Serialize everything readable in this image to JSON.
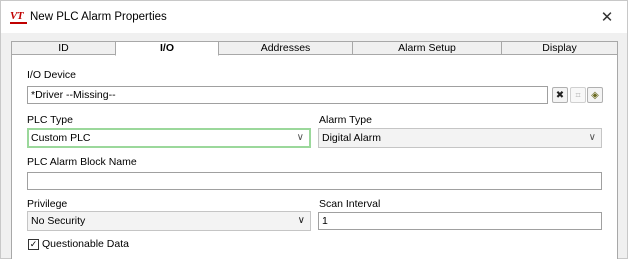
{
  "window": {
    "title": "New PLC Alarm Properties",
    "logo_text": "VT",
    "close_glyph": "✕"
  },
  "tabs": [
    {
      "label": "ID",
      "active": false
    },
    {
      "label": "I/O",
      "active": true
    },
    {
      "label": "Addresses",
      "active": false
    },
    {
      "label": "Alarm Setup",
      "active": false
    },
    {
      "label": "Display",
      "active": false
    }
  ],
  "io_device": {
    "label": "I/O Device",
    "value": "*Driver   --Missing--",
    "buttons": [
      "clear-icon",
      "tree-icon",
      "browse-icon"
    ]
  },
  "plc_type": {
    "label": "PLC Type",
    "value": "Custom PLC"
  },
  "alarm_type": {
    "label": "Alarm Type",
    "value": "Digital Alarm"
  },
  "plc_alarm_block_name": {
    "label": "PLC Alarm Block Name",
    "value": ""
  },
  "privilege": {
    "label": "Privilege",
    "value": "No Security"
  },
  "scan_interval": {
    "label": "Scan Interval",
    "value": "1"
  },
  "questionable_data": {
    "label": "Questionable Data",
    "checked": true
  },
  "colors": {
    "logo": "#c00000",
    "focus_border": "#9bd89b"
  }
}
